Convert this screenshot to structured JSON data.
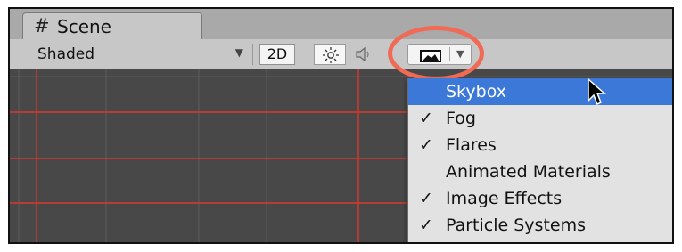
{
  "tab": {
    "icon": "grid-hash-icon",
    "title": "Scene"
  },
  "toolbar": {
    "shading_mode": "Shaded",
    "toggle_2d_label": "2D",
    "lighting_icon": "sun-icon",
    "audio_icon": "speaker-icon",
    "effects_icon": "image-landscape-icon"
  },
  "menu": {
    "items": [
      {
        "label": "Skybox",
        "checked": false,
        "highlighted": true
      },
      {
        "label": "Fog",
        "checked": true,
        "highlighted": false
      },
      {
        "label": "Flares",
        "checked": true,
        "highlighted": false
      },
      {
        "label": "Animated Materials",
        "checked": false,
        "highlighted": false
      },
      {
        "label": "Image Effects",
        "checked": true,
        "highlighted": false
      },
      {
        "label": "Particle Systems",
        "checked": true,
        "highlighted": false
      }
    ]
  },
  "colors": {
    "grid_line": "#d9382c",
    "grid_line_dim": "#5a5a5a",
    "highlight_ring": "#f06a55",
    "menu_selection": "#3b78d8"
  }
}
